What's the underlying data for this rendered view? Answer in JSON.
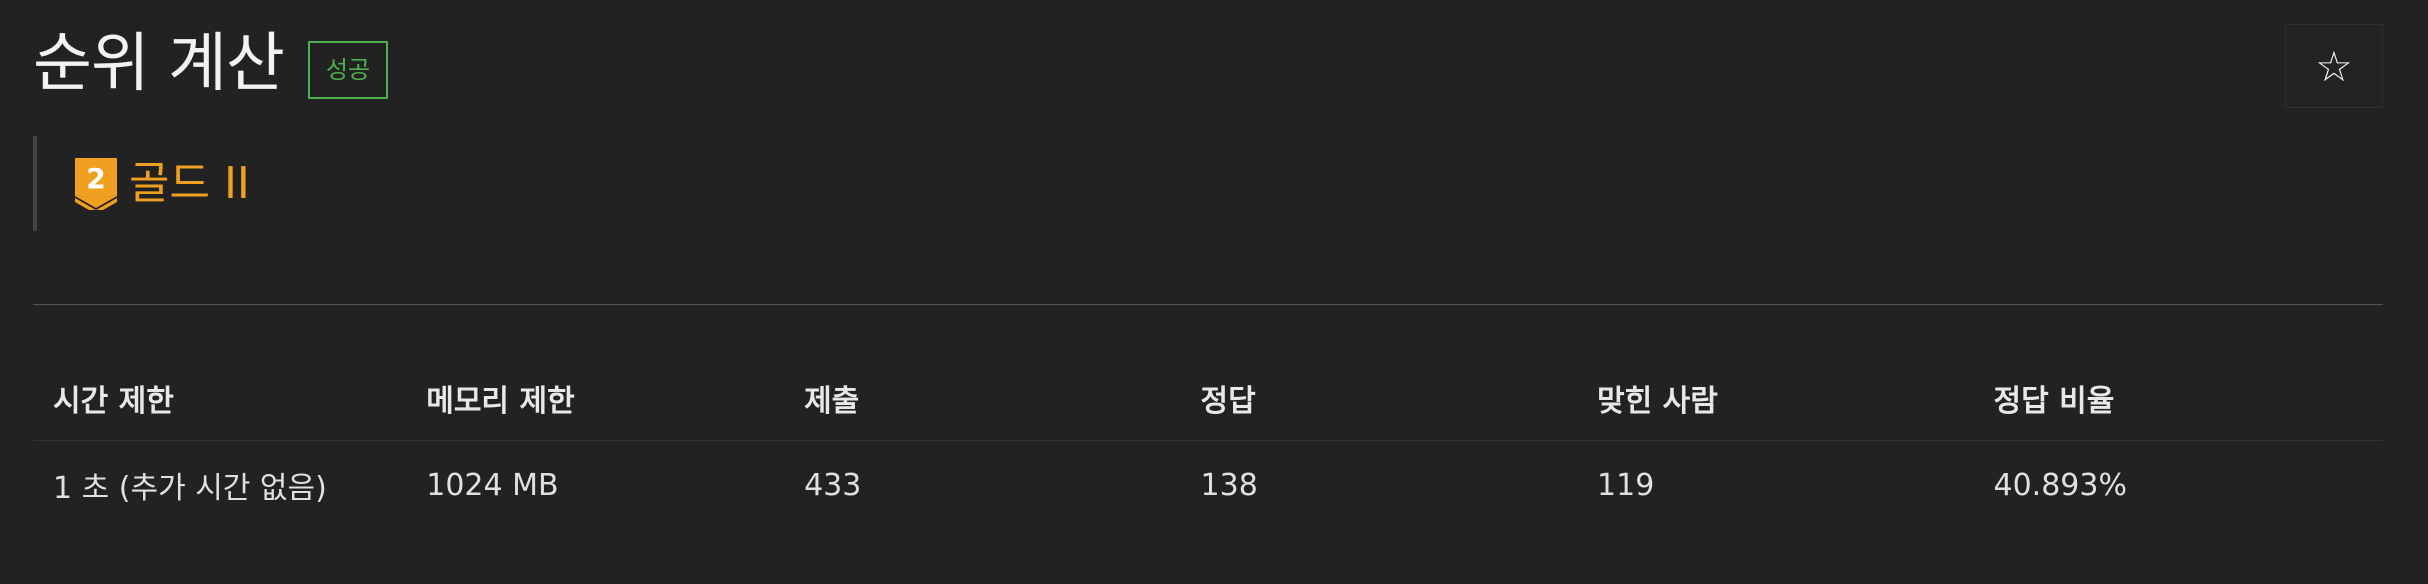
{
  "problem": {
    "title": "순위 계산",
    "status_badge": "성공",
    "star_icon": "star-outline-icon"
  },
  "tier": {
    "icon_name": "gold-tier-badge-icon",
    "icon_number": "2",
    "label": "골드 II",
    "color": "#f0a021"
  },
  "info_table": {
    "headers": [
      "시간 제한",
      "메모리 제한",
      "제출",
      "정답",
      "맞힌 사람",
      "정답 비율"
    ],
    "values": [
      "1 초 (추가 시간 없음)",
      "1024 MB",
      "433",
      "138",
      "119",
      "40.893%"
    ]
  },
  "colors": {
    "background": "#222222",
    "success": "#4caf50",
    "gold": "#f0a021"
  }
}
